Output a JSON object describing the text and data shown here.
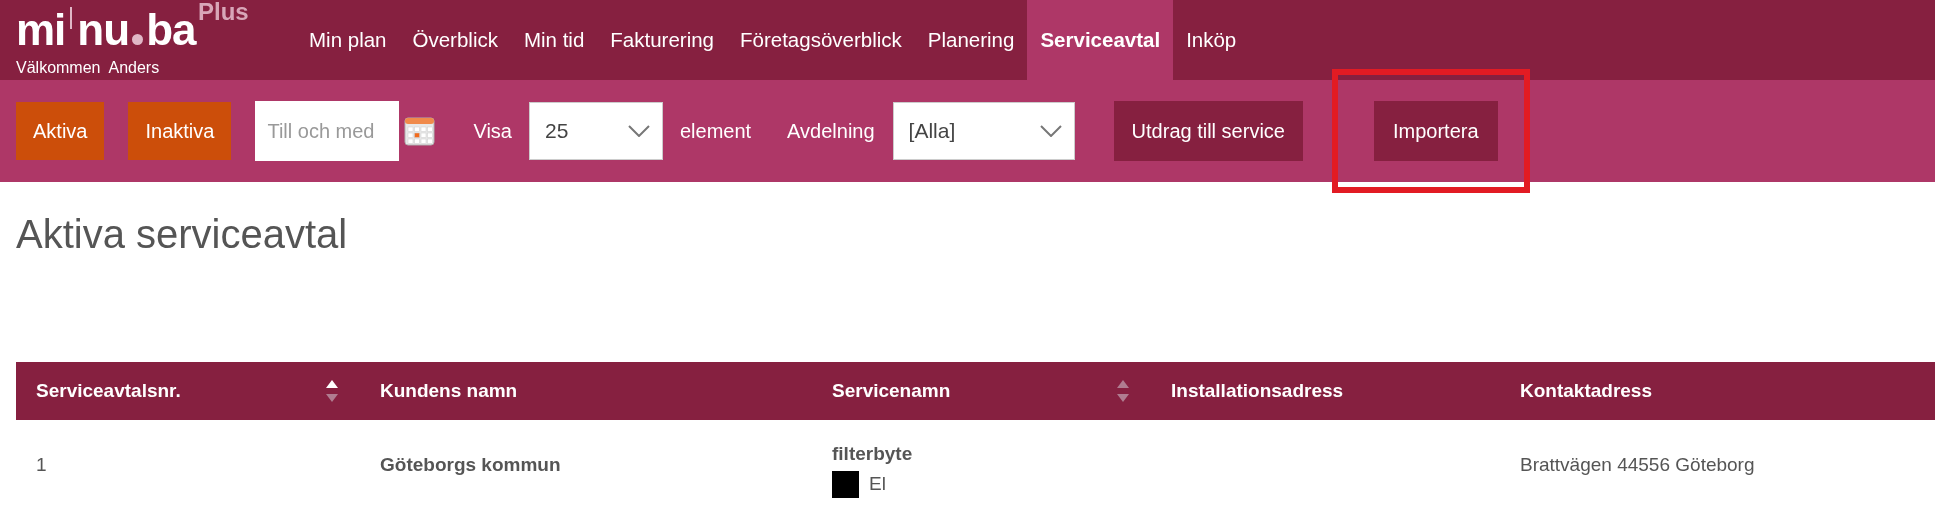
{
  "logo": {
    "parts": [
      "mi",
      "nu",
      "ba"
    ],
    "badge": "Plus",
    "welcome": "Välkommen  Anders"
  },
  "nav": [
    {
      "label": "Min plan",
      "selected": false
    },
    {
      "label": "Överblick",
      "selected": false
    },
    {
      "label": "Min tid",
      "selected": false
    },
    {
      "label": "Fakturering",
      "selected": false
    },
    {
      "label": "Företagsöverblick",
      "selected": false
    },
    {
      "label": "Planering",
      "selected": false
    },
    {
      "label": "Serviceavtal",
      "selected": true
    },
    {
      "label": "Inköp",
      "selected": false
    }
  ],
  "toolbar": {
    "filters": [
      {
        "label": "Aktiva"
      },
      {
        "label": "Inaktiva"
      }
    ],
    "date_field": {
      "placeholder": "Till och med"
    },
    "show_label": "Visa",
    "show_select": "25",
    "show_suffix": "element",
    "department_label": "Avdelning",
    "department_select": "[Alla]",
    "actions": [
      {
        "label": "Utdrag till service",
        "highlighted": false
      },
      {
        "label": "Importera",
        "highlighted": true
      }
    ]
  },
  "page_title": "Aktiva serviceavtal",
  "table": {
    "columns": [
      {
        "label": "Serviceavtalsnr.",
        "sorted": true
      },
      {
        "label": "Kundens namn"
      },
      {
        "label": "Servicenamn",
        "sorted": false
      },
      {
        "label": "Installationsadress"
      },
      {
        "label": "Kontaktadress"
      }
    ],
    "rows": [
      {
        "number": "1",
        "customer": "Göteborgs kommun",
        "service": "filterbyte",
        "service_type": "El",
        "color": "#000000",
        "contact_address": "Brattvägen 44556 Göteborg"
      }
    ]
  }
}
